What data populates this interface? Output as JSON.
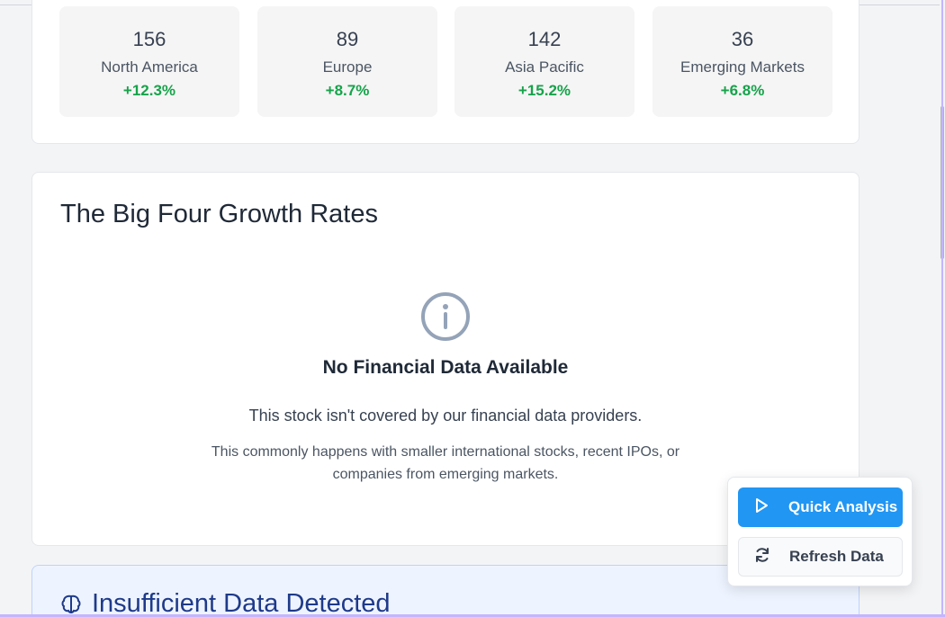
{
  "regions": [
    {
      "count": "156",
      "name": "North America",
      "change": "+12.3%"
    },
    {
      "count": "89",
      "name": "Europe",
      "change": "+8.7%"
    },
    {
      "count": "142",
      "name": "Asia Pacific",
      "change": "+15.2%"
    },
    {
      "count": "36",
      "name": "Emerging Markets",
      "change": "+6.8%"
    }
  ],
  "growth": {
    "title": "The Big Four Growth Rates",
    "empty_title": "No Financial Data Available",
    "empty_desc": "This stock isn't covered by our financial data providers.",
    "empty_sub": "This commonly happens with smaller international stocks, recent IPOs, or companies from emerging markets."
  },
  "warning": {
    "title": "Insufficient Data Detected"
  },
  "actions": {
    "quick_analysis": "Quick Analysis",
    "refresh_data": "Refresh Data"
  },
  "colors": {
    "positive": "#16a34a",
    "primary_button": "#2196f3",
    "warning_title": "#1e3a8a"
  },
  "icons": {
    "info": "info-circle-icon",
    "play": "play-icon",
    "refresh": "refresh-icon",
    "brain": "brain-icon"
  }
}
